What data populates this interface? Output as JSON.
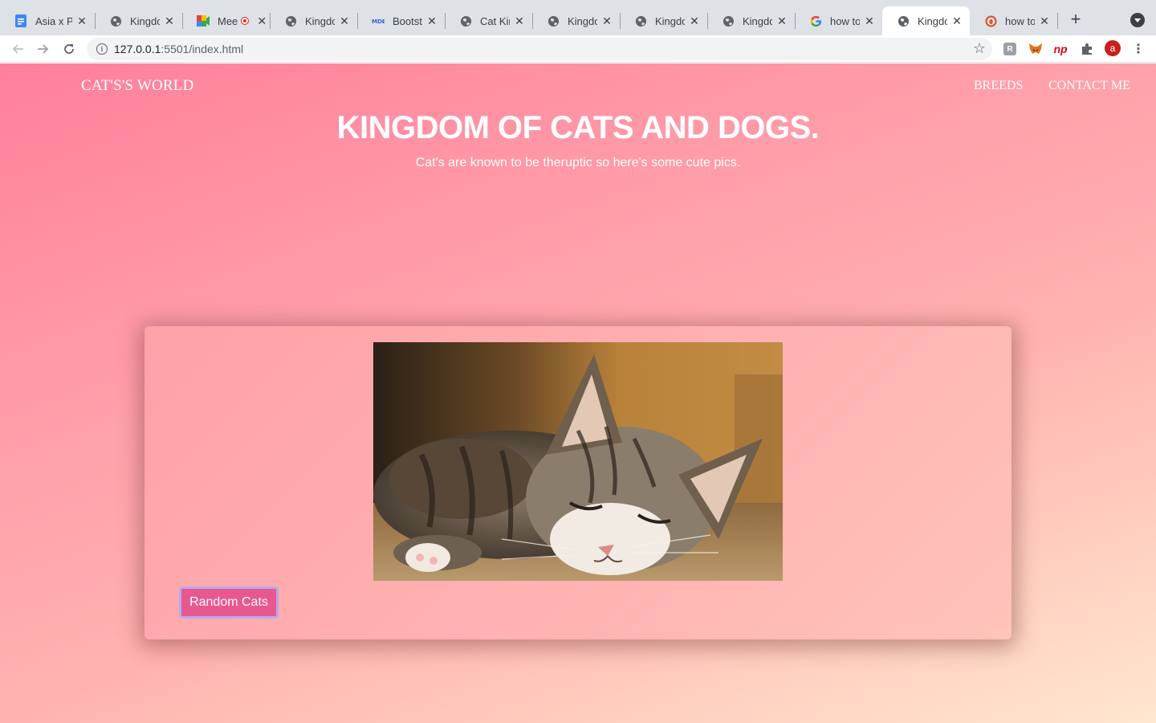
{
  "browser": {
    "tabs": [
      {
        "title": "Asia x P",
        "icon": "docs-icon"
      },
      {
        "title": "Kingdon",
        "icon": "globe-icon"
      },
      {
        "title": "Mee",
        "icon": "meet-icon",
        "recording": true
      },
      {
        "title": "Kingdon",
        "icon": "globe-icon"
      },
      {
        "title": "Bootstr",
        "icon": "mdb-icon"
      },
      {
        "title": "Cat King",
        "icon": "globe-icon"
      },
      {
        "title": "Kingdon",
        "icon": "globe-icon"
      },
      {
        "title": "Kingdon",
        "icon": "globe-icon"
      },
      {
        "title": "Kingdon",
        "icon": "globe-icon"
      },
      {
        "title": "how to r",
        "icon": "google-icon"
      },
      {
        "title": "Kingdon",
        "icon": "globe-icon",
        "active": true
      },
      {
        "title": "how to I",
        "icon": "duckduckgo-icon"
      }
    ],
    "url_host": "127.0.0.1",
    "url_rest": ":5501/index.html",
    "profile_initial": "a"
  },
  "page": {
    "brand": "CAT'S'S WORLD",
    "nav": [
      "BREEDS",
      "CONTACT ME"
    ],
    "title": "KINGDOM OF CATS AND DOGS.",
    "subtitle": "Cat's are known to be theruptic so here's some cute pics.",
    "button_label": "Random Cats",
    "image_alt": "kitten-photo"
  },
  "colors": {
    "gradient_start": "#ff7f9b",
    "gradient_end": "#ffe7cc",
    "button": "#e8588f",
    "button_border": "#b9a8ee"
  }
}
